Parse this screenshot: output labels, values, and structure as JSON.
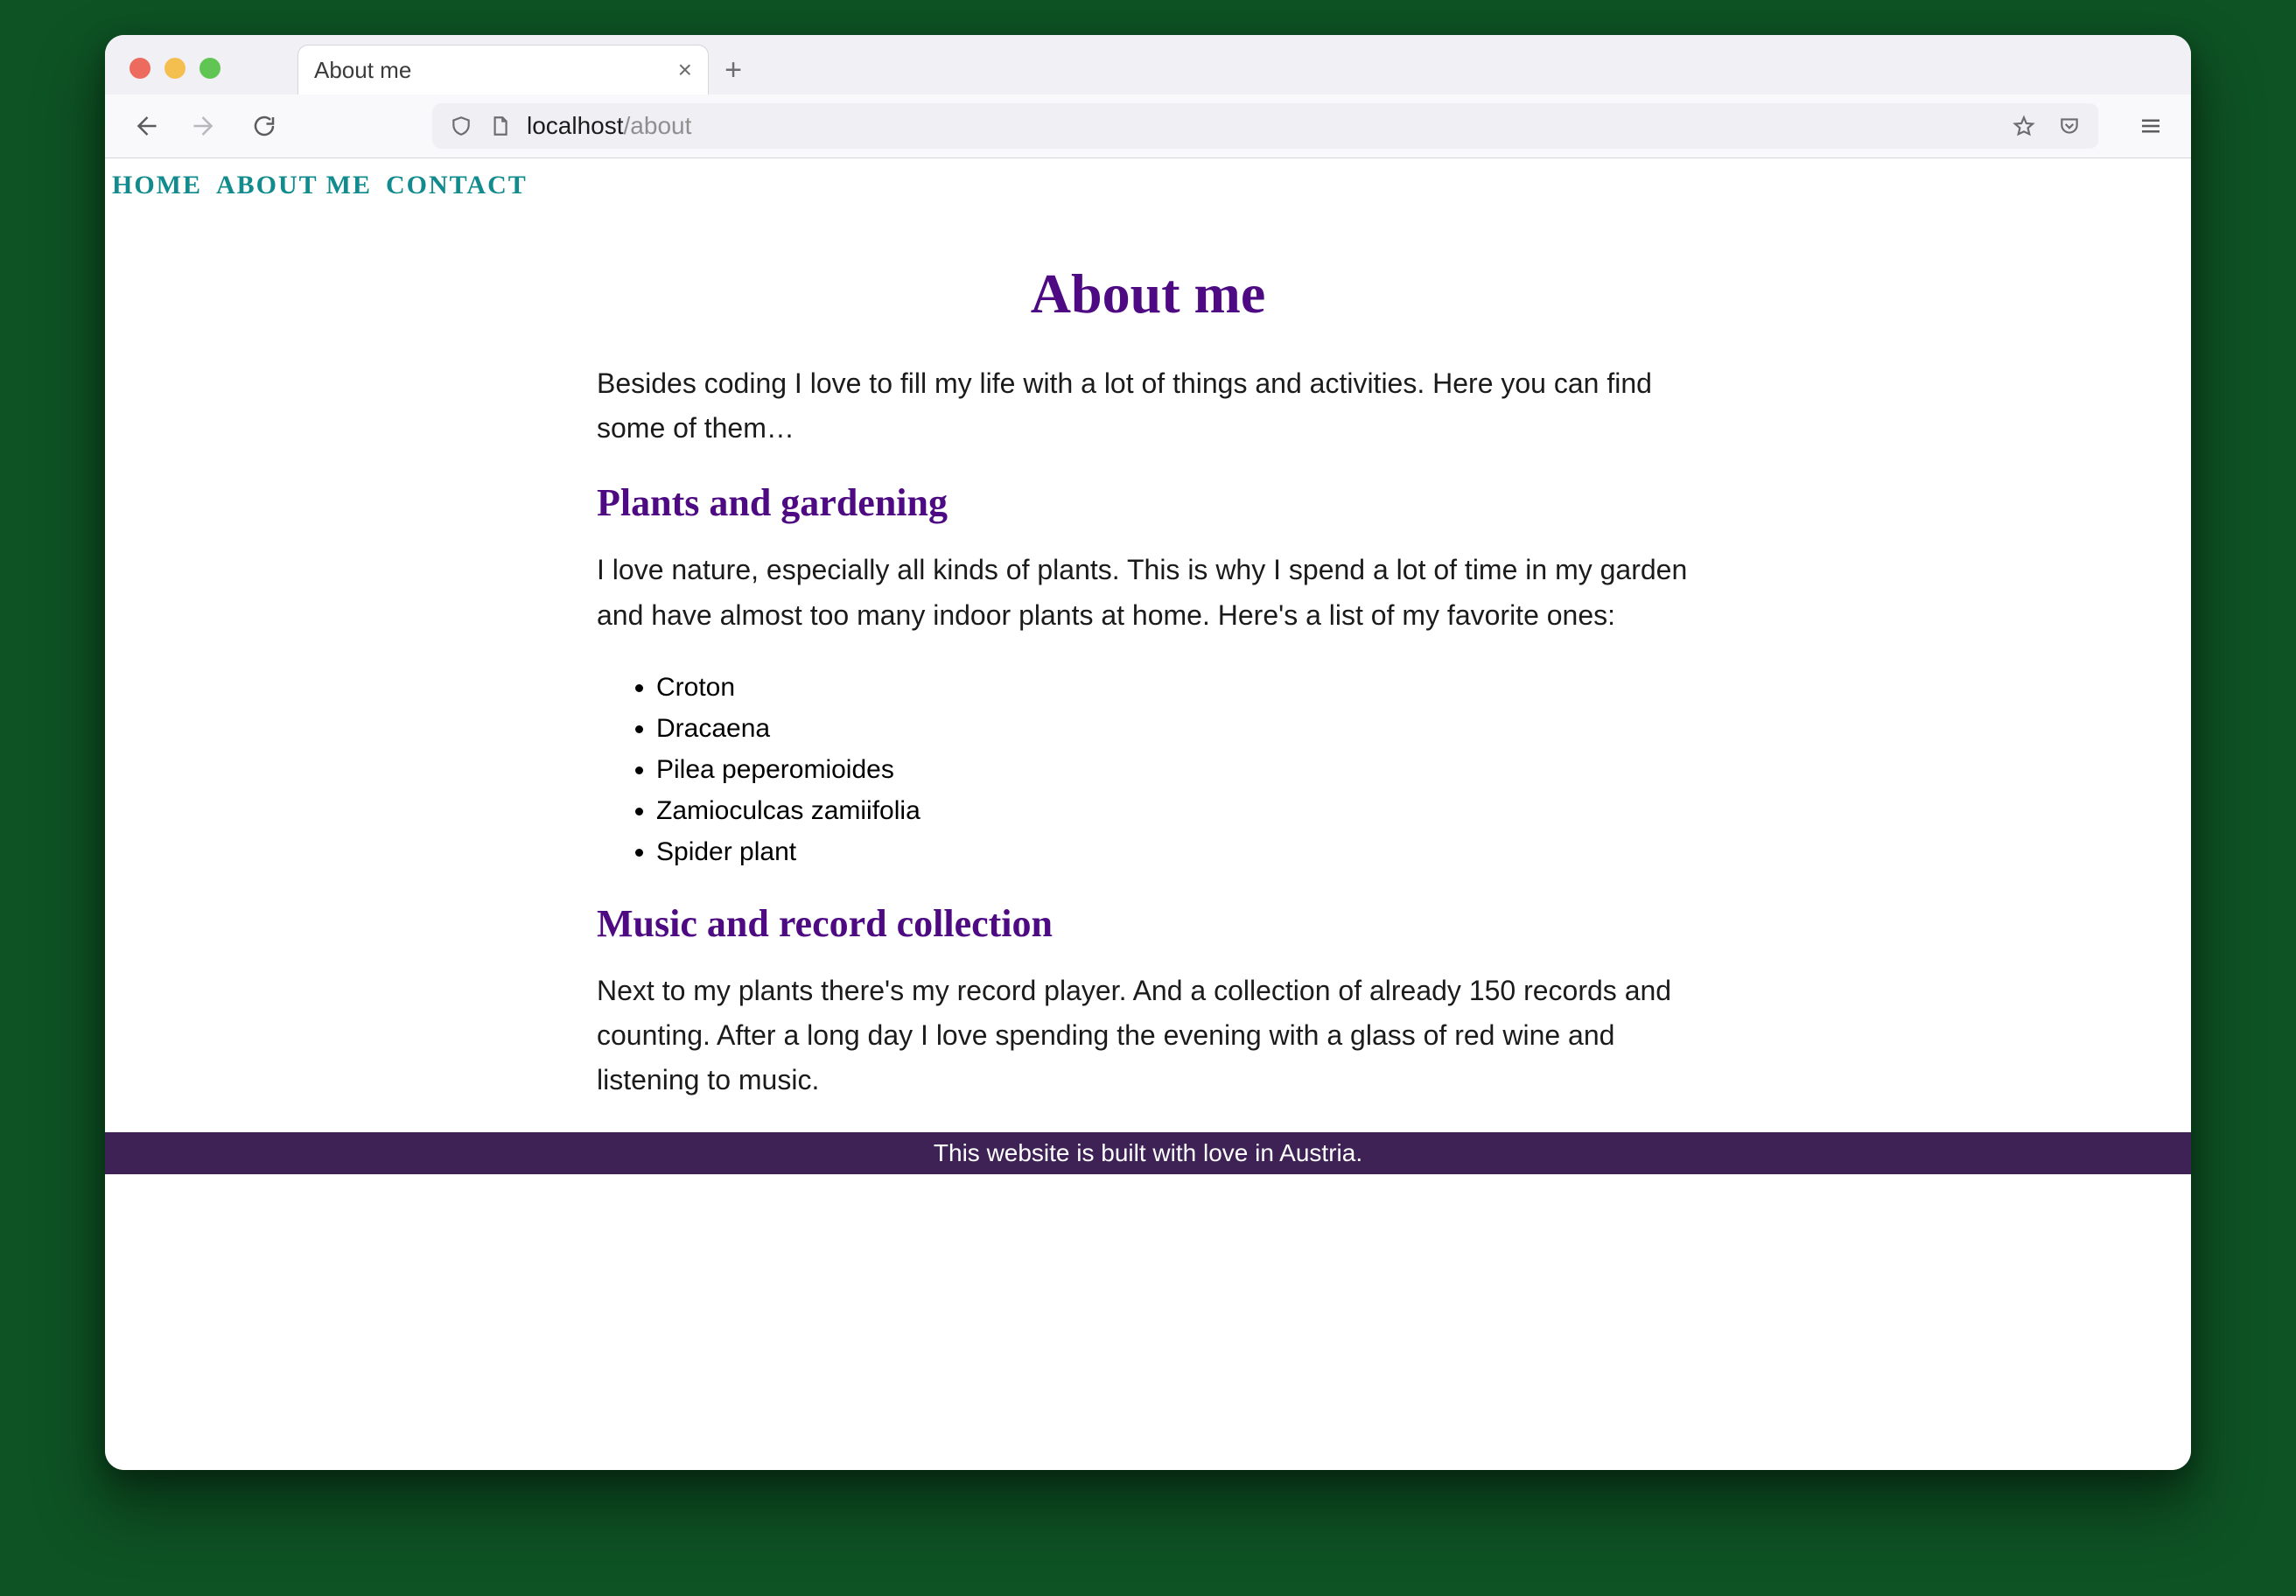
{
  "browser": {
    "tab_title": "About me",
    "url_host": "localhost",
    "url_path": "/about"
  },
  "nav": {
    "home": "HOME",
    "about": "ABOUT ME",
    "contact": "CONTACT"
  },
  "page": {
    "title": "About me",
    "intro": "Besides coding I love to fill my life with a lot of things and activities. Here you can find some of them…",
    "section1_title": "Plants and gardening",
    "section1_body": "I love nature, especially all kinds of plants. This is why I spend a lot of time in my garden and have almost too many indoor plants at home. Here's a list of my favorite ones:",
    "plants": [
      "Croton",
      "Dracaena",
      "Pilea peperomioides",
      "Zamioculcas zamiifolia",
      "Spider plant"
    ],
    "section2_title": "Music and record collection",
    "section2_body": "Next to my plants there's my record player. And a collection of already 150 records and counting. After a long day I love spending the evening with a glass of red wine and listening to music.",
    "footer": "This website is built with love in Austria."
  }
}
